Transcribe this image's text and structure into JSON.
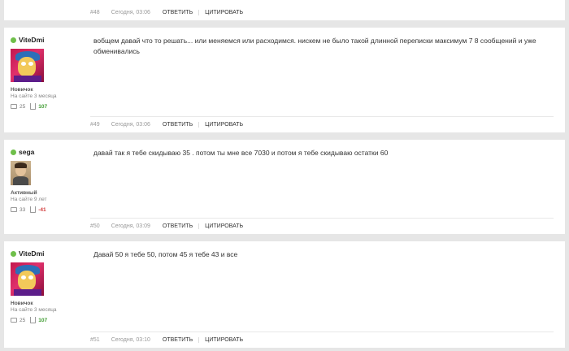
{
  "actions": {
    "reply": "ОТВЕТИТЬ",
    "quote": "ЦИТИРОВАТЬ"
  },
  "colors": {
    "online": "#6fbf4a",
    "positive": "#3c9a2e",
    "negative": "#d23a3a"
  },
  "icons": {
    "messages": "chat-bubble-icon",
    "reputation": "reputation-icon",
    "online": "online-dot-icon"
  },
  "top_stub": {
    "number": "#48",
    "date": "Сегодня, 03:06"
  },
  "posts": [
    {
      "author": "ViteDmi",
      "rank": "Новичок",
      "since": "На сайте 3 месяца",
      "messages": "25",
      "reputation": "107",
      "text": "вобщем давай что то решать... или меняемся или расходимся. нискем не было такой длинной переписки максимум 7 8 сообщений и уже обменивались",
      "number": "#49",
      "date": "Сегодня, 03:06"
    },
    {
      "author": "sega",
      "rank": "Активный",
      "since": "На сайте 9 лет",
      "messages": "33",
      "reputation": "-41",
      "text": "давай так я тебе скидываю 35 . потом ты мне все 7030 и потом я тебе скидываю остатки 60",
      "number": "#50",
      "date": "Сегодня, 03:09"
    },
    {
      "author": "ViteDmi",
      "rank": "Новичок",
      "since": "На сайте 3 месяца",
      "messages": "25",
      "reputation": "107",
      "text": "Давай 50 я тебе 50, потом 45 я тебе 43  и все",
      "number": "#51",
      "date": "Сегодня, 03:10"
    }
  ]
}
